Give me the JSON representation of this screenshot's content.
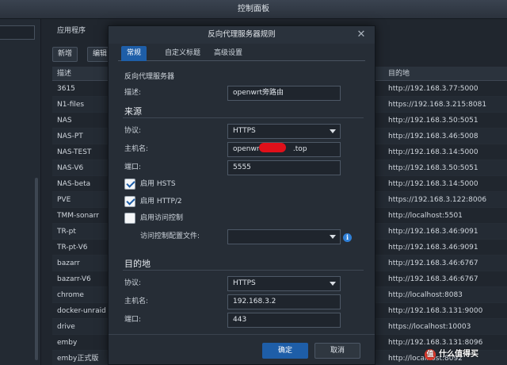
{
  "window_title": "控制面板",
  "app_tab": "应用程序",
  "toolbar": {
    "new_label": "新增",
    "edit_label": "编辑"
  },
  "table": {
    "col_description": "描述",
    "col_destination": "目的地",
    "rows": [
      {
        "name": "3615",
        "dest": "http://192.168.3.77:5000"
      },
      {
        "name": "N1-files",
        "dest": "https://192.168.3.215:8081"
      },
      {
        "name": "NAS",
        "dest": "http://192.168.3.50:5051"
      },
      {
        "name": "NAS-PT",
        "dest": "http://192.168.3.46:5008"
      },
      {
        "name": "NAS-TEST",
        "dest": "http://192.168.3.14:5000"
      },
      {
        "name": "NAS-V6",
        "dest": "http://192.168.3.50:5051"
      },
      {
        "name": "NAS-beta",
        "dest": "http://192.168.3.14:5000"
      },
      {
        "name": "PVE",
        "dest": "https://192.168.3.122:8006"
      },
      {
        "name": "TMM-sonarr",
        "dest": "http://localhost:5501"
      },
      {
        "name": "TR-pt",
        "dest": "http://192.168.3.46:9091"
      },
      {
        "name": "TR-pt-V6",
        "dest": "http://192.168.3.46:9091"
      },
      {
        "name": "bazarr",
        "dest": "http://192.168.3.46:6767"
      },
      {
        "name": "bazarr-V6",
        "dest": "http://192.168.3.46:6767"
      },
      {
        "name": "chrome",
        "dest": "http://localhost:8083"
      },
      {
        "name": "docker-unraid",
        "dest": "http://192.168.3.131:9000"
      },
      {
        "name": "drive",
        "dest": "https://localhost:10003"
      },
      {
        "name": "emby",
        "dest": "http://192.168.3.131:8096"
      },
      {
        "name": "emby正式版",
        "dest": "http://localhost:8092"
      }
    ]
  },
  "dialog": {
    "title": "反向代理服务器规则",
    "tabs": [
      "常规",
      "自定义标题",
      "高级设置"
    ],
    "section_proxy": "反向代理服务器",
    "desc_label": "描述:",
    "desc_value": "openwrt旁路由",
    "source_head": "来源",
    "src_protocol_label": "协议:",
    "src_protocol_value": "HTTPS",
    "src_host_label": "主机名:",
    "src_host_prefix": "openwrt.",
    "src_host_suffix": ".top",
    "src_port_label": "端口:",
    "src_port_value": "5555",
    "hsts_label": "启用 HSTS",
    "http2_label": "启用 HTTP/2",
    "access_label": "启用访问控制",
    "access_profile_label": "访问控制配置文件:",
    "dest_head": "目的地",
    "dst_protocol_label": "协议:",
    "dst_protocol_value": "HTTPS",
    "dst_host_label": "主机名:",
    "dst_host_value": "192.168.3.2",
    "dst_port_label": "端口:",
    "dst_port_value": "443",
    "ok_label": "确定",
    "cancel_label": "取消"
  },
  "watermark": "值 什么值得买",
  "colors": {
    "accent": "#1e5ea8",
    "redaction": "#e0101a"
  }
}
